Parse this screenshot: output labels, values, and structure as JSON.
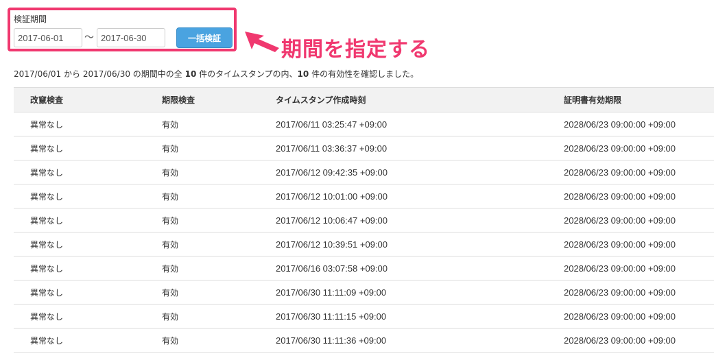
{
  "filter": {
    "label": "検証期間",
    "start_date": "2017-06-01",
    "end_date": "2017-06-30",
    "separator": "〜",
    "button_label": "一括検証"
  },
  "annotation": {
    "text": "期間を指定する",
    "color": "#f0386f"
  },
  "summary": {
    "start": "2017/06/01",
    "t1": " から ",
    "end": "2017/06/30",
    "t2": " の期間中の全 ",
    "total": "10",
    "t3": " 件のタイムスタンプの内、",
    "valid": "10",
    "t4": " 件の有効性を確認しました。"
  },
  "table": {
    "headers": [
      "改竄検査",
      "期限検査",
      "タイムスタンプ作成時刻",
      "証明書有効期限"
    ],
    "rows": [
      [
        "異常なし",
        "有効",
        "2017/06/11 03:25:47 +09:00",
        "2028/06/23 09:00:00 +09:00"
      ],
      [
        "異常なし",
        "有効",
        "2017/06/11 03:36:37 +09:00",
        "2028/06/23 09:00:00 +09:00"
      ],
      [
        "異常なし",
        "有効",
        "2017/06/12 09:42:35 +09:00",
        "2028/06/23 09:00:00 +09:00"
      ],
      [
        "異常なし",
        "有効",
        "2017/06/12 10:01:00 +09:00",
        "2028/06/23 09:00:00 +09:00"
      ],
      [
        "異常なし",
        "有効",
        "2017/06/12 10:06:47 +09:00",
        "2028/06/23 09:00:00 +09:00"
      ],
      [
        "異常なし",
        "有効",
        "2017/06/12 10:39:51 +09:00",
        "2028/06/23 09:00:00 +09:00"
      ],
      [
        "異常なし",
        "有効",
        "2017/06/16 03:07:58 +09:00",
        "2028/06/23 09:00:00 +09:00"
      ],
      [
        "異常なし",
        "有効",
        "2017/06/30 11:11:09 +09:00",
        "2028/06/23 09:00:00 +09:00"
      ],
      [
        "異常なし",
        "有効",
        "2017/06/30 11:11:15 +09:00",
        "2028/06/23 09:00:00 +09:00"
      ],
      [
        "異常なし",
        "有効",
        "2017/06/30 11:11:36 +09:00",
        "2028/06/23 09:00:00 +09:00"
      ]
    ]
  },
  "colors": {
    "accent": "#f0386f",
    "button": "#4aa3e0",
    "header_bg": "#f2f2f2"
  }
}
